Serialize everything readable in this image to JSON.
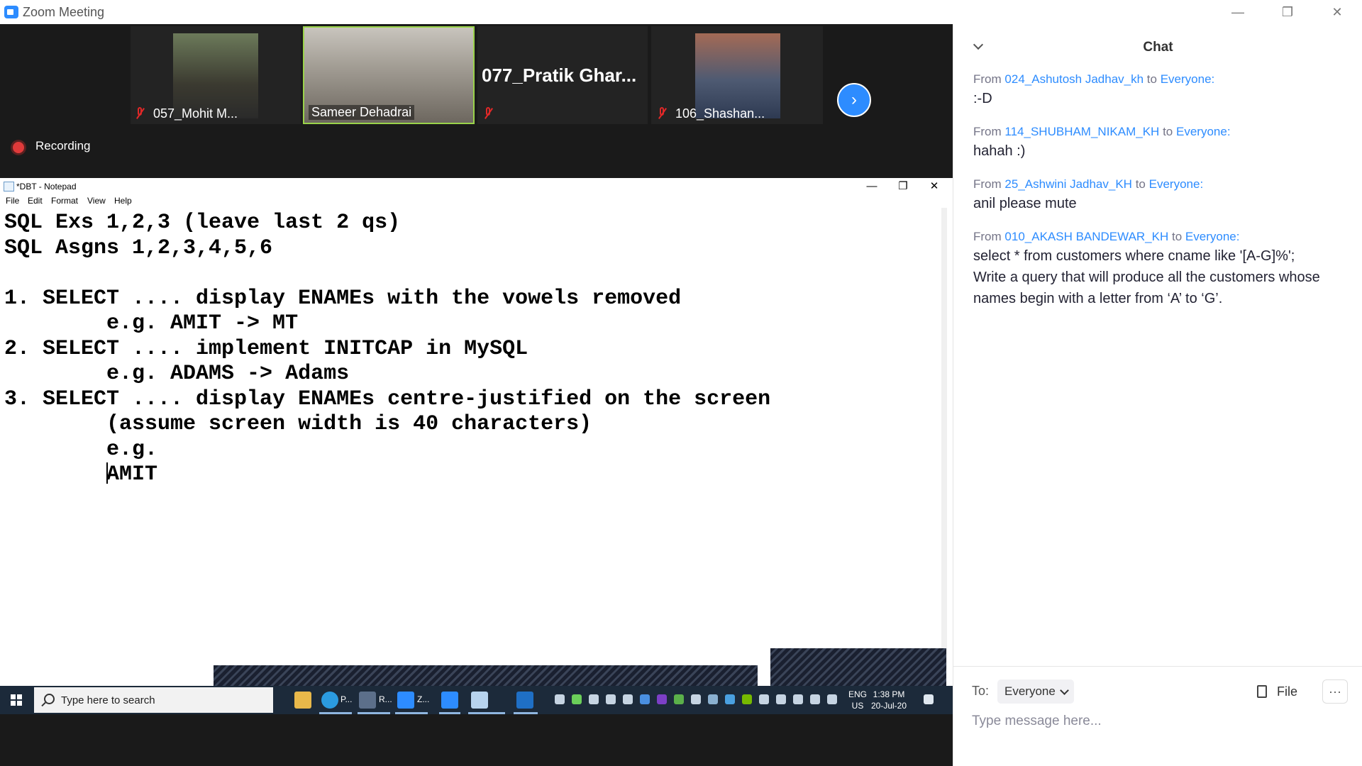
{
  "window": {
    "title": "Zoom Meeting",
    "minimize": "—",
    "restore": "❐",
    "close": "✕"
  },
  "participants": [
    {
      "name": "057_Mohit M...",
      "muted": true
    },
    {
      "name": "Sameer Dehadrai",
      "muted": false,
      "active": true
    },
    {
      "name": "077_Pratik  Ghar...",
      "muted": true
    },
    {
      "name": "106_Shashan...",
      "muted": true
    }
  ],
  "recording_label": "Recording",
  "notepad": {
    "title": "*DBT - Notepad",
    "menu": [
      "File",
      "Edit",
      "Format",
      "View",
      "Help"
    ],
    "lines": [
      "SQL Exs 1,2,3 (leave last 2 qs)",
      "SQL Asgns 1,2,3,4,5,6",
      "",
      "1. SELECT .... display ENAMEs with the vowels removed",
      "        e.g. AMIT -> MT",
      "2. SELECT .... implement INITCAP in MySQL",
      "        e.g. ADAMS -> Adams",
      "3. SELECT .... display ENAMEs centre-justified on the screen",
      "        (assume screen width is 40 characters)",
      "        e.g.",
      "        AMIT"
    ]
  },
  "taskbar": {
    "search_placeholder": "Type here to search",
    "apps": [
      "P...",
      "R...",
      "Z..."
    ],
    "lang": "ENG",
    "region": "US",
    "time": "1:38 PM",
    "date": "20-Jul-20"
  },
  "chat": {
    "title": "Chat",
    "messages": [
      {
        "from_label": "From",
        "sender": "024_Ashutosh Jadhav_kh",
        "to_label": "to",
        "recipient": "Everyone:",
        "text": ":-D"
      },
      {
        "from_label": "From",
        "sender": "114_SHUBHAM_NIKAM_KH",
        "to_label": "to",
        "recipient": "Everyone:",
        "text": "hahah :)"
      },
      {
        "from_label": "From",
        "sender": "25_Ashwini Jadhav_KH",
        "to_label": "to",
        "recipient": "Everyone:",
        "text": "anil please mute"
      },
      {
        "from_label": "From",
        "sender": "010_AKASH BANDEWAR_KH",
        "to_label": "to",
        "recipient": "Everyone:",
        "text": "select * from customers where cname like '[A-G]%';\nWrite a query that will produce all the customers whose names begin with a letter from ‘A’ to ‘G’."
      }
    ],
    "to_label": "To:",
    "to_value": "Everyone",
    "file_label": "File",
    "more_label": "···",
    "input_placeholder": "Type message here..."
  },
  "colors": {
    "zoom_blue": "#2d8cff",
    "meeting_bg": "#1a1a1a",
    "active_tile_border": "#9ad34a",
    "muted_red": "#e02828"
  }
}
